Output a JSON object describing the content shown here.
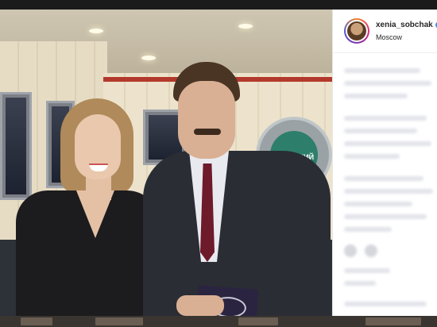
{
  "post": {
    "username": "xenia_sobchak",
    "verified_symbol": "✓",
    "location": "Moscow"
  },
  "scene": {
    "studio_logo_text": "ВЕЧЕРНИЙ УРГАНТ"
  },
  "colors": {
    "instagram_blue": "#3897f0",
    "panel_bg": "#ffffff",
    "wall": "#e6dcc4",
    "accent_red": "#b3392c"
  }
}
